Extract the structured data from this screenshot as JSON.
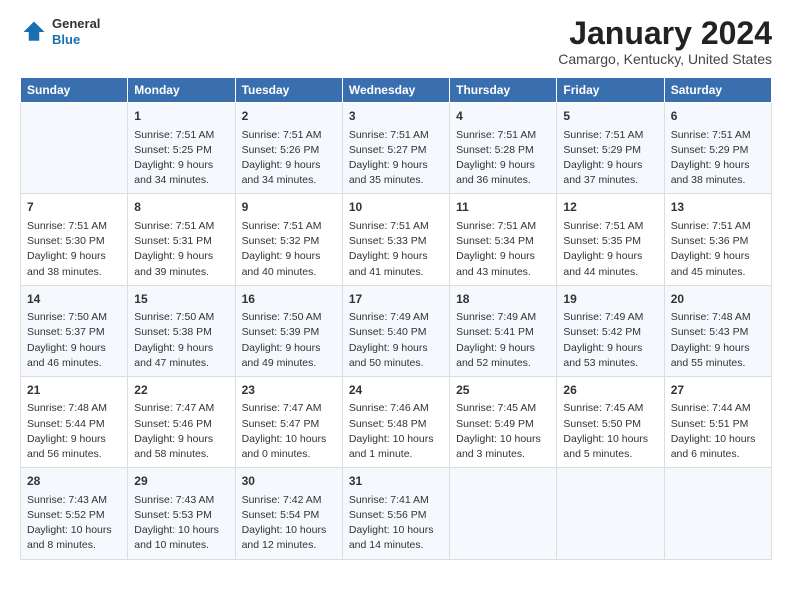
{
  "header": {
    "logo": {
      "general": "General",
      "blue": "Blue",
      "icon": "▶"
    },
    "title": "January 2024",
    "subtitle": "Camargo, Kentucky, United States"
  },
  "days_of_week": [
    "Sunday",
    "Monday",
    "Tuesday",
    "Wednesday",
    "Thursday",
    "Friday",
    "Saturday"
  ],
  "weeks": [
    [
      {
        "day": "",
        "content": ""
      },
      {
        "day": "1",
        "content": "Sunrise: 7:51 AM\nSunset: 5:25 PM\nDaylight: 9 hours\nand 34 minutes."
      },
      {
        "day": "2",
        "content": "Sunrise: 7:51 AM\nSunset: 5:26 PM\nDaylight: 9 hours\nand 34 minutes."
      },
      {
        "day": "3",
        "content": "Sunrise: 7:51 AM\nSunset: 5:27 PM\nDaylight: 9 hours\nand 35 minutes."
      },
      {
        "day": "4",
        "content": "Sunrise: 7:51 AM\nSunset: 5:28 PM\nDaylight: 9 hours\nand 36 minutes."
      },
      {
        "day": "5",
        "content": "Sunrise: 7:51 AM\nSunset: 5:29 PM\nDaylight: 9 hours\nand 37 minutes."
      },
      {
        "day": "6",
        "content": "Sunrise: 7:51 AM\nSunset: 5:29 PM\nDaylight: 9 hours\nand 38 minutes."
      }
    ],
    [
      {
        "day": "7",
        "content": "Sunrise: 7:51 AM\nSunset: 5:30 PM\nDaylight: 9 hours\nand 38 minutes."
      },
      {
        "day": "8",
        "content": "Sunrise: 7:51 AM\nSunset: 5:31 PM\nDaylight: 9 hours\nand 39 minutes."
      },
      {
        "day": "9",
        "content": "Sunrise: 7:51 AM\nSunset: 5:32 PM\nDaylight: 9 hours\nand 40 minutes."
      },
      {
        "day": "10",
        "content": "Sunrise: 7:51 AM\nSunset: 5:33 PM\nDaylight: 9 hours\nand 41 minutes."
      },
      {
        "day": "11",
        "content": "Sunrise: 7:51 AM\nSunset: 5:34 PM\nDaylight: 9 hours\nand 43 minutes."
      },
      {
        "day": "12",
        "content": "Sunrise: 7:51 AM\nSunset: 5:35 PM\nDaylight: 9 hours\nand 44 minutes."
      },
      {
        "day": "13",
        "content": "Sunrise: 7:51 AM\nSunset: 5:36 PM\nDaylight: 9 hours\nand 45 minutes."
      }
    ],
    [
      {
        "day": "14",
        "content": "Sunrise: 7:50 AM\nSunset: 5:37 PM\nDaylight: 9 hours\nand 46 minutes."
      },
      {
        "day": "15",
        "content": "Sunrise: 7:50 AM\nSunset: 5:38 PM\nDaylight: 9 hours\nand 47 minutes."
      },
      {
        "day": "16",
        "content": "Sunrise: 7:50 AM\nSunset: 5:39 PM\nDaylight: 9 hours\nand 49 minutes."
      },
      {
        "day": "17",
        "content": "Sunrise: 7:49 AM\nSunset: 5:40 PM\nDaylight: 9 hours\nand 50 minutes."
      },
      {
        "day": "18",
        "content": "Sunrise: 7:49 AM\nSunset: 5:41 PM\nDaylight: 9 hours\nand 52 minutes."
      },
      {
        "day": "19",
        "content": "Sunrise: 7:49 AM\nSunset: 5:42 PM\nDaylight: 9 hours\nand 53 minutes."
      },
      {
        "day": "20",
        "content": "Sunrise: 7:48 AM\nSunset: 5:43 PM\nDaylight: 9 hours\nand 55 minutes."
      }
    ],
    [
      {
        "day": "21",
        "content": "Sunrise: 7:48 AM\nSunset: 5:44 PM\nDaylight: 9 hours\nand 56 minutes."
      },
      {
        "day": "22",
        "content": "Sunrise: 7:47 AM\nSunset: 5:46 PM\nDaylight: 9 hours\nand 58 minutes."
      },
      {
        "day": "23",
        "content": "Sunrise: 7:47 AM\nSunset: 5:47 PM\nDaylight: 10 hours\nand 0 minutes."
      },
      {
        "day": "24",
        "content": "Sunrise: 7:46 AM\nSunset: 5:48 PM\nDaylight: 10 hours\nand 1 minute."
      },
      {
        "day": "25",
        "content": "Sunrise: 7:45 AM\nSunset: 5:49 PM\nDaylight: 10 hours\nand 3 minutes."
      },
      {
        "day": "26",
        "content": "Sunrise: 7:45 AM\nSunset: 5:50 PM\nDaylight: 10 hours\nand 5 minutes."
      },
      {
        "day": "27",
        "content": "Sunrise: 7:44 AM\nSunset: 5:51 PM\nDaylight: 10 hours\nand 6 minutes."
      }
    ],
    [
      {
        "day": "28",
        "content": "Sunrise: 7:43 AM\nSunset: 5:52 PM\nDaylight: 10 hours\nand 8 minutes."
      },
      {
        "day": "29",
        "content": "Sunrise: 7:43 AM\nSunset: 5:53 PM\nDaylight: 10 hours\nand 10 minutes."
      },
      {
        "day": "30",
        "content": "Sunrise: 7:42 AM\nSunset: 5:54 PM\nDaylight: 10 hours\nand 12 minutes."
      },
      {
        "day": "31",
        "content": "Sunrise: 7:41 AM\nSunset: 5:56 PM\nDaylight: 10 hours\nand 14 minutes."
      },
      {
        "day": "",
        "content": ""
      },
      {
        "day": "",
        "content": ""
      },
      {
        "day": "",
        "content": ""
      }
    ]
  ]
}
